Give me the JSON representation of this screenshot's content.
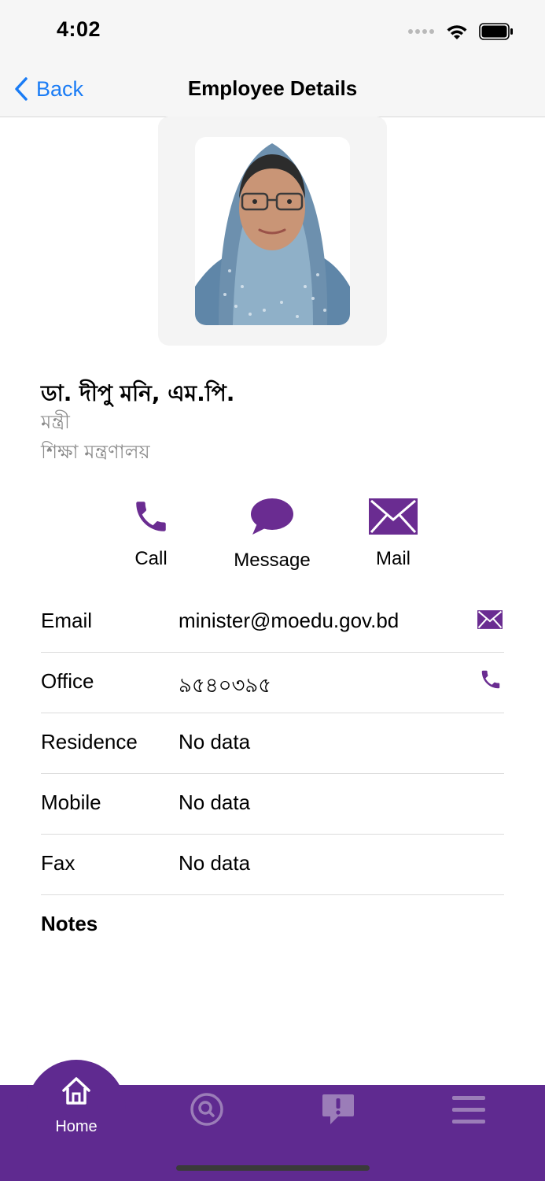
{
  "status": {
    "time": "4:02"
  },
  "nav": {
    "back_label": "Back",
    "title": "Employee Details"
  },
  "person": {
    "name": "ডা. দীপু মনি, এম.পি.",
    "designation": "মন্ত্রী",
    "department": "শিক্ষা মন্ত্রণালয়"
  },
  "actions": [
    {
      "label": "Call",
      "icon": "phone-icon"
    },
    {
      "label": "Message",
      "icon": "chat-bubble-icon"
    },
    {
      "label": "Mail",
      "icon": "envelope-icon"
    }
  ],
  "details": [
    {
      "label": "Email",
      "value": "minister@moedu.gov.bd",
      "icon": "envelope-icon"
    },
    {
      "label": "Office",
      "value": "৯৫৪০৩৯৫",
      "icon": "phone-icon"
    },
    {
      "label": "Residence",
      "value": "No data"
    },
    {
      "label": "Mobile",
      "value": "No data"
    },
    {
      "label": "Fax",
      "value": "No data"
    }
  ],
  "notes_label": "Notes",
  "tabbar": {
    "home_label": "Home"
  },
  "colors": {
    "accent": "#6a2c91",
    "tabbar": "#5f2a90",
    "ios_blue": "#1a7cf5"
  }
}
